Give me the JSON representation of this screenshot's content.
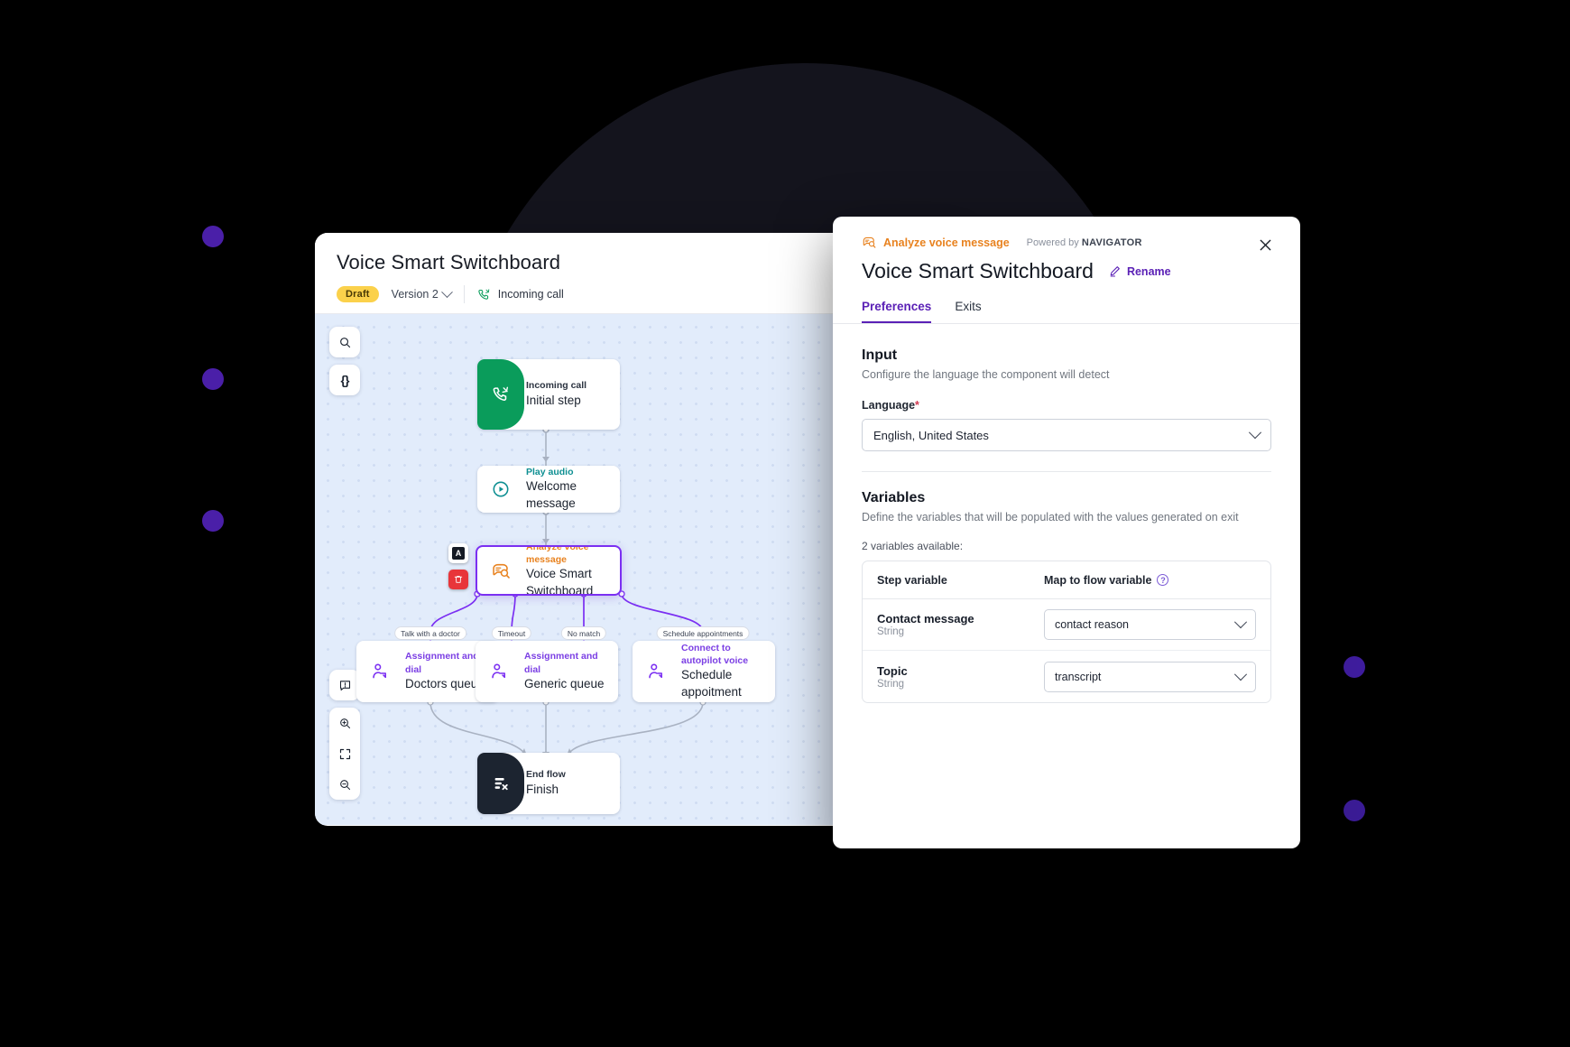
{
  "editor": {
    "title": "Voice Smart Switchboard",
    "status_badge": "Draft",
    "version": "Version 2",
    "trigger": "Incoming call",
    "tools_top": [
      {
        "name": "search-icon",
        "label": "Search"
      },
      {
        "name": "code-braces-icon",
        "label": "{}"
      }
    ],
    "tools_bottom": [
      {
        "name": "comment-icon",
        "label": "Comment"
      },
      {
        "name": "zoom-in-icon",
        "label": "Zoom in"
      },
      {
        "name": "fit-screen-icon",
        "label": "Fit to screen"
      },
      {
        "name": "zoom-out-icon",
        "label": "Zoom out"
      }
    ],
    "nodes": [
      {
        "kind": "Incoming call",
        "name": "Initial step",
        "style": "green"
      },
      {
        "kind": "Play audio",
        "name": "Welcome message",
        "style": "teal"
      },
      {
        "kind": "Analyze voice message",
        "name": "Voice Smart Switchboard",
        "style": "orange",
        "selected": true
      },
      {
        "kind": "Assignment and dial",
        "name": "Doctors queue",
        "style": "purple"
      },
      {
        "kind": "Assignment and dial",
        "name": "Generic queue",
        "style": "purple"
      },
      {
        "kind": "Connect to autopilot voice",
        "name": "Schedule appoitment",
        "style": "purple"
      },
      {
        "kind": "End flow",
        "name": "Finish",
        "style": "dark"
      }
    ],
    "node_badges": [
      {
        "name": "annotate-badge",
        "label": "A"
      },
      {
        "name": "delete-badge",
        "label": "🗑"
      }
    ],
    "edge_labels": [
      "Talk with a doctor",
      "Timeout",
      "No match",
      "Schedule appointments"
    ]
  },
  "panel": {
    "eyebrow": "Analyze voice message",
    "powered_prefix": "Powered by",
    "powered_brand": "NAVIGATOR",
    "title": "Voice Smart Switchboard",
    "rename": "Rename",
    "close": "×",
    "tabs": [
      {
        "label": "Preferences",
        "active": true
      },
      {
        "label": "Exits",
        "active": false
      }
    ],
    "input": {
      "heading": "Input",
      "description": "Configure the language the component will detect",
      "language_label": "Language",
      "required_mark": "*",
      "language_value": "English, United States"
    },
    "variables": {
      "heading": "Variables",
      "description": "Define the variables that will be populated with the values generated on exit",
      "count_text": "2 variables available:",
      "col_step": "Step variable",
      "col_map": "Map to flow variable",
      "rows": [
        {
          "name": "Contact message",
          "type": "String",
          "mapped": "contact reason"
        },
        {
          "name": "Topic",
          "type": "String",
          "mapped": "transcript"
        }
      ]
    }
  },
  "colors": {
    "accent_purple": "#5b21b6",
    "node_purple": "#7b2ff2",
    "orange": "#e8821f",
    "teal": "#0e8f92",
    "green": "#0a9c5b",
    "draft_yellow": "#fbd14b",
    "canvas": "#e2ecfb",
    "backdrop": "#14141d"
  }
}
